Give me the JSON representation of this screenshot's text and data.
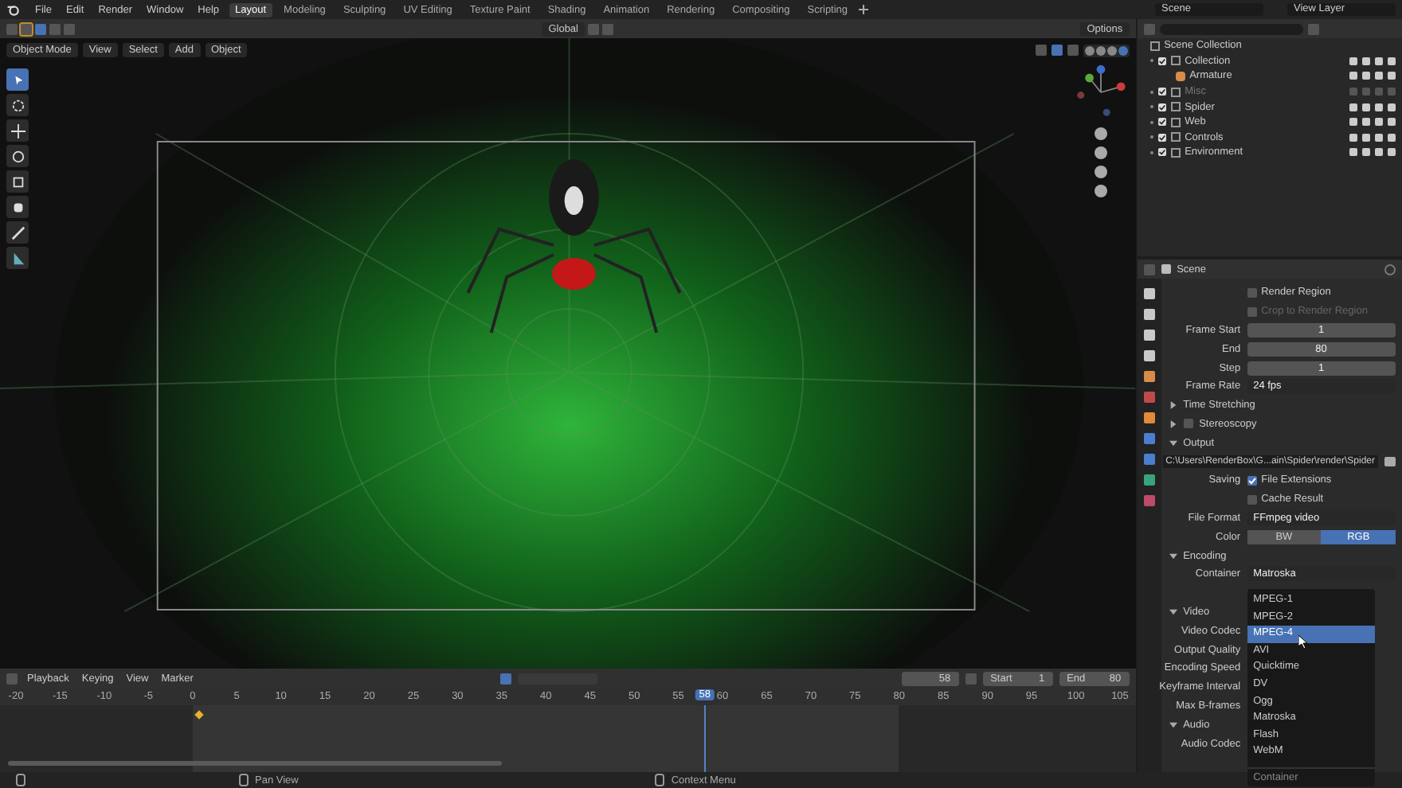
{
  "menu": [
    "File",
    "Edit",
    "Render",
    "Window",
    "Help"
  ],
  "workspaces": [
    {
      "label": "Layout",
      "selected": true
    },
    {
      "label": "Modeling",
      "selected": false
    },
    {
      "label": "Sculpting",
      "selected": false
    },
    {
      "label": "UV Editing",
      "selected": false
    },
    {
      "label": "Texture Paint",
      "selected": false
    },
    {
      "label": "Shading",
      "selected": false
    },
    {
      "label": "Animation",
      "selected": false
    },
    {
      "label": "Rendering",
      "selected": false
    },
    {
      "label": "Compositing",
      "selected": false
    },
    {
      "label": "Scripting",
      "selected": false
    }
  ],
  "scene": "Scene",
  "view_layer": "View Layer",
  "tool_header": {
    "orientation": "Global",
    "options": "Options"
  },
  "viewport_header": {
    "mode": "Object Mode",
    "menus": [
      "View",
      "Select",
      "Add",
      "Object"
    ]
  },
  "tools": [
    {
      "kind": "select",
      "selected": true
    },
    {
      "kind": "cursor",
      "selected": false
    },
    {
      "kind": "move",
      "selected": false
    },
    {
      "kind": "rotate",
      "selected": false
    },
    {
      "kind": "scale",
      "selected": false
    },
    {
      "kind": "transform",
      "selected": false
    },
    {
      "kind": "annotate",
      "selected": false
    },
    {
      "kind": "measure",
      "selected": false
    }
  ],
  "outliner": {
    "root": "Scene Collection",
    "items": [
      {
        "label": "Collection",
        "checked": true,
        "disabled": false,
        "children": [
          {
            "label": "Armature",
            "disabled": false
          }
        ]
      },
      {
        "label": "Misc",
        "checked": true,
        "disabled": true
      },
      {
        "label": "Spider",
        "checked": true,
        "disabled": false
      },
      {
        "label": "Web",
        "checked": true,
        "disabled": false
      },
      {
        "label": "Controls",
        "checked": true,
        "disabled": false
      },
      {
        "label": "Environment",
        "checked": true,
        "disabled": false
      }
    ]
  },
  "properties": {
    "title": "Scene",
    "rows": [
      {
        "kind": "checkbox",
        "label": "Render Region",
        "checked": false,
        "disabled": false
      },
      {
        "kind": "checkbox",
        "label": "Crop to Render Region",
        "checked": false,
        "disabled": true
      },
      {
        "kind": "field",
        "label": "Frame Start",
        "value": "1"
      },
      {
        "kind": "field",
        "label": "End",
        "value": "80"
      },
      {
        "kind": "field",
        "label": "Step",
        "value": "1"
      },
      {
        "kind": "dropdown",
        "label": "Frame Rate",
        "value": "24 fps"
      },
      {
        "kind": "panel",
        "label": "Time Stretching",
        "expanded": false
      },
      {
        "kind": "panel",
        "label": "Stereoscopy",
        "expanded": false,
        "checked": false
      },
      {
        "kind": "panel",
        "label": "Output",
        "expanded": true
      },
      {
        "kind": "path",
        "value": "C:\\Users\\RenderBox\\G...ain\\Spider\\render\\Spider"
      },
      {
        "kind": "checkbox",
        "prefix": "Saving",
        "label": "File Extensions",
        "checked": true,
        "disabled": false
      },
      {
        "kind": "checkbox",
        "label": "Cache Result",
        "checked": false,
        "disabled": false
      },
      {
        "kind": "dropdown",
        "label": "File Format",
        "value": "FFmpeg video"
      },
      {
        "kind": "toggle",
        "label": "Color",
        "options": [
          {
            "label": "BW",
            "selected": false
          },
          {
            "label": "RGB",
            "selected": true
          }
        ]
      },
      {
        "kind": "panel",
        "label": "Encoding",
        "expanded": true
      },
      {
        "kind": "dropdown",
        "label": "Container",
        "value": "Matroska"
      },
      {
        "kind": "gap"
      },
      {
        "kind": "panel",
        "label": "Video",
        "expanded": true
      },
      {
        "kind": "label",
        "label": "Video Codec"
      },
      {
        "kind": "label",
        "label": "Output Quality"
      },
      {
        "kind": "label",
        "label": "Encoding Speed"
      },
      {
        "kind": "label",
        "label": "Keyframe Interval"
      },
      {
        "kind": "label",
        "label": "Max B-frames"
      },
      {
        "kind": "panel",
        "label": "Audio",
        "expanded": true
      },
      {
        "kind": "label",
        "label": "Audio Codec"
      }
    ]
  },
  "container_menu": {
    "options": [
      {
        "label": "MPEG-1",
        "selected": false
      },
      {
        "label": "MPEG-2",
        "selected": false
      },
      {
        "label": "MPEG-4",
        "selected": true
      },
      {
        "label": "AVI",
        "selected": false
      },
      {
        "label": "Quicktime",
        "selected": false
      },
      {
        "label": "DV",
        "selected": false
      },
      {
        "label": "Ogg",
        "selected": false
      },
      {
        "label": "Matroska",
        "selected": false
      },
      {
        "label": "Flash",
        "selected": false
      },
      {
        "label": "WebM",
        "selected": false
      }
    ],
    "footer": "Container"
  },
  "timeline": {
    "menus": [
      "Playback",
      "Keying",
      "View",
      "Marker"
    ],
    "current": "58",
    "playhead_frame": "58",
    "start_label": "Start",
    "start": "1",
    "end_label": "End",
    "end": "80",
    "ticks": [
      "-20",
      "-15",
      "-10",
      "-5",
      "0",
      "5",
      "10",
      "15",
      "20",
      "25",
      "30",
      "35",
      "40",
      "45",
      "50",
      "55",
      "60",
      "65",
      "70",
      "75",
      "80",
      "85",
      "90",
      "95",
      "100",
      "105"
    ]
  },
  "status_bar": [
    "Pan View",
    "Context Menu"
  ]
}
